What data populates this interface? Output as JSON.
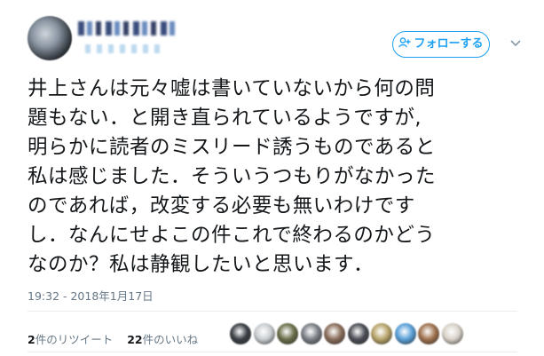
{
  "follow_button": {
    "label": "フォローする"
  },
  "tweet": {
    "text": "井上さんは元々嘘は書いていないから何の問\n題もない．と開き直られているようですが,\n明らかに読者のミスリード誘うものであると\n私は感じました．そういうつもりがなかった\nのであれば，改変する必要も無いわけです\nし．なんにせよこの件これで終わるのかどう\nなのか？私は静観したいと思います．",
    "timestamp": "19:32 - 2018年1月17日"
  },
  "stats": {
    "retweets": {
      "count": "2",
      "label": "件のリツイート"
    },
    "likes": {
      "count": "22",
      "label": "件のいいね"
    }
  },
  "likers": [
    {
      "color": "#3a3f45"
    },
    {
      "color": "#c9cdd1"
    },
    {
      "color": "#6b6f4a"
    },
    {
      "color": "#7a7f86"
    },
    {
      "color": "#8a6d5a"
    },
    {
      "color": "#4a4e55"
    },
    {
      "color": "#b8a46a"
    },
    {
      "color": "#5aa0d8"
    },
    {
      "color": "#a0724e"
    },
    {
      "color": "#d9d2c8"
    }
  ],
  "colors": {
    "accent": "#1da1f2",
    "text": "#14171a",
    "muted": "#657786",
    "divider": "#e6ecf0"
  }
}
